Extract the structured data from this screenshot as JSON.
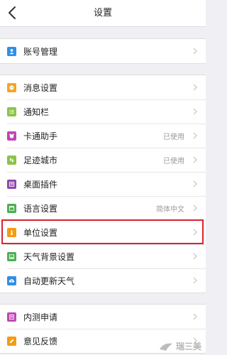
{
  "header": {
    "title": "设置"
  },
  "groups": [
    {
      "items": [
        {
          "label": "账号管理",
          "icon": "user-icon",
          "color": "#2f8ee8"
        }
      ]
    },
    {
      "items": [
        {
          "label": "消息设置",
          "icon": "message-icon",
          "color": "#f4a623"
        },
        {
          "label": "通知栏",
          "icon": "list-icon",
          "color": "#8bc34a"
        },
        {
          "label": "卡通助手",
          "value": "已使用",
          "icon": "cartoon-icon",
          "color": "#c046b4"
        },
        {
          "label": "足迹城市",
          "value": "已使用",
          "icon": "footprint-icon",
          "color": "#8bc34a"
        },
        {
          "label": "桌面插件",
          "icon": "widget-icon",
          "color": "#8e44ad"
        },
        {
          "label": "语言设置",
          "value": "简体中文",
          "icon": "language-icon",
          "color": "#4caf50"
        },
        {
          "label": "单位设置",
          "icon": "thermometer-icon",
          "color": "#f39c12"
        },
        {
          "label": "天气背景设置",
          "icon": "picture-icon",
          "color": "#4caf50"
        },
        {
          "label": "自动更新天气",
          "icon": "cloud-update-icon",
          "color": "#2f8ee8"
        }
      ]
    },
    {
      "items": [
        {
          "label": "内测申请",
          "icon": "beta-icon",
          "color": "#c046b4"
        },
        {
          "label": "意见反馈",
          "icon": "feedback-icon",
          "color": "#f39c12"
        }
      ]
    }
  ],
  "watermark": {
    "text": "瑞三美"
  },
  "colors": {
    "highlight": "#d9232f",
    "background": "#efeff4"
  }
}
